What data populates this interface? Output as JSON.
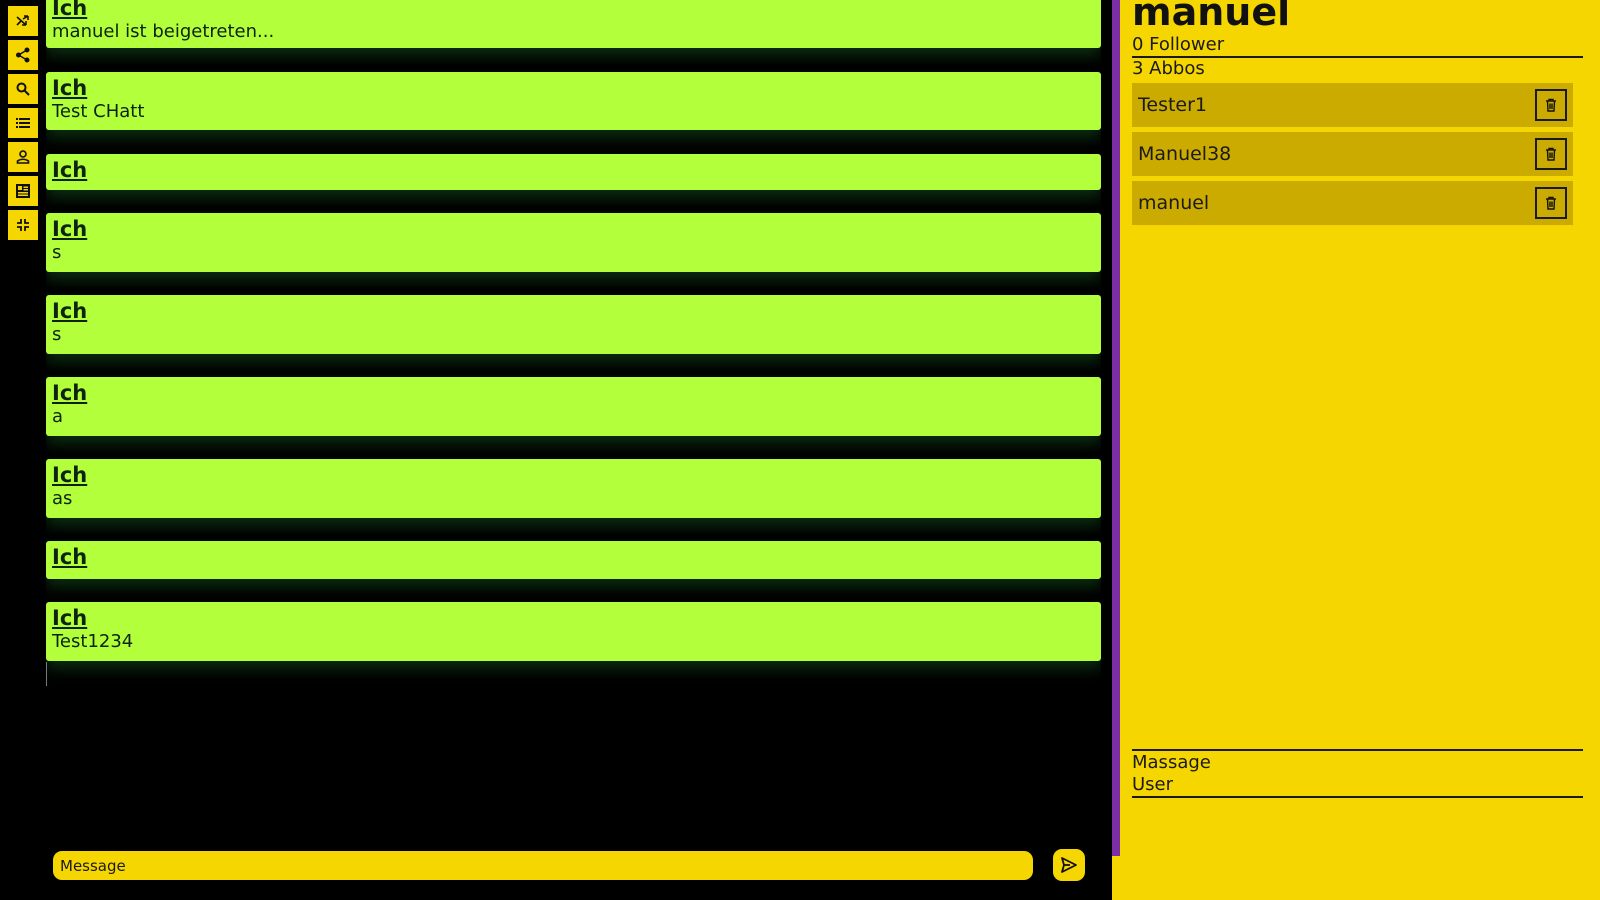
{
  "toolbar": {
    "buttons": [
      {
        "icon": "shuffle-icon"
      },
      {
        "icon": "share-icon"
      },
      {
        "icon": "search-icon"
      },
      {
        "icon": "list-icon"
      },
      {
        "icon": "user-icon"
      },
      {
        "icon": "newspaper-icon"
      },
      {
        "icon": "collapse-icon"
      }
    ]
  },
  "chat": {
    "messages": [
      {
        "author": "Ich",
        "text": "manuel ist beigetreten..."
      },
      {
        "author": "Ich",
        "text": "Test CHatt"
      },
      {
        "author": "Ich",
        "text": ""
      },
      {
        "author": "Ich",
        "text": "s"
      },
      {
        "author": "Ich",
        "text": "s"
      },
      {
        "author": "Ich",
        "text": "a"
      },
      {
        "author": "Ich",
        "text": "as"
      },
      {
        "author": "Ich",
        "text": ""
      },
      {
        "author": "Ich",
        "text": "Test1234"
      }
    ]
  },
  "composer": {
    "placeholder": "Message",
    "value": ""
  },
  "profile": {
    "name": "manuel",
    "followers": "0 Follower",
    "abbos": "3 Abbos",
    "subscriptions": [
      {
        "name": "Tester1"
      },
      {
        "name": "Manuel38"
      },
      {
        "name": "manuel"
      }
    ],
    "links": {
      "massage": "Massage",
      "user": "User"
    }
  },
  "colors": {
    "background": "#000000",
    "message_bg": "#b3ff3c",
    "accent_yellow": "#f6d600",
    "list_item_bg": "#ccab00",
    "divider_violet": "#7a2fa5",
    "text_dark": "#1a1a1a"
  }
}
